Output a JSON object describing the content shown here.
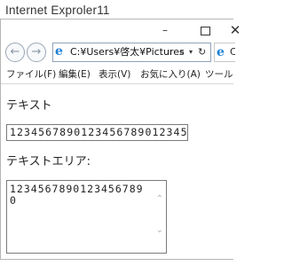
{
  "caption": "Internet Exproler11",
  "window": {
    "minimize": "–",
    "close": "✕"
  },
  "nav": {
    "back": "←",
    "forward": "→",
    "address": "C:¥Users¥啓太¥Pictures",
    "search_icon": "⌕",
    "dropdown_icon": "▾",
    "refresh_icon": "↻",
    "ie_logo": "e",
    "tab_text": "C"
  },
  "menu": [
    {
      "label": "ファイル(F)"
    },
    {
      "label": "編集(E)"
    },
    {
      "label": "表示(V)"
    },
    {
      "label": "お気に入り(A)"
    },
    {
      "label": "ツール(T"
    }
  ],
  "page": {
    "text_label": "テキスト",
    "text_value": "1234567890123456789012345",
    "textarea_label": "テキストエリア:",
    "textarea_value": "12345678901234567890",
    "scroll_up": "⌃",
    "scroll_down": "⌄"
  },
  "colors": {
    "ie_blue": "#1b7fd4",
    "border": "#7a7a7a"
  }
}
